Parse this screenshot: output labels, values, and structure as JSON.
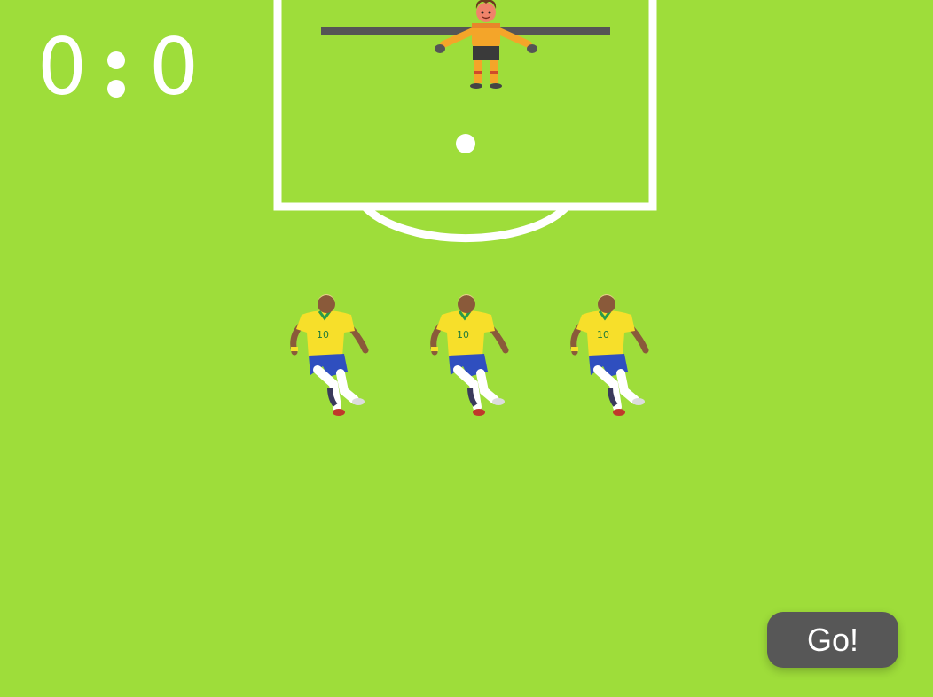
{
  "score": {
    "left": "0",
    "right": "0"
  },
  "kick_button": {
    "label": "Go!"
  },
  "goalkeeper": {
    "icon": "goalkeeper-icon"
  },
  "ball": {
    "icon": "ball-icon"
  },
  "players": [
    {
      "icon": "player-icon",
      "shirt_number": "10"
    },
    {
      "icon": "player-icon",
      "shirt_number": "10"
    },
    {
      "icon": "player-icon",
      "shirt_number": "10"
    }
  ],
  "colors": {
    "pitch": "#9edd3a",
    "lines": "#ffffff",
    "crossbar": "#555555",
    "button": "#575757",
    "shirt": "#f7df2a",
    "shorts": "#2f4fbf",
    "keeper_kit": "#f4a529"
  }
}
